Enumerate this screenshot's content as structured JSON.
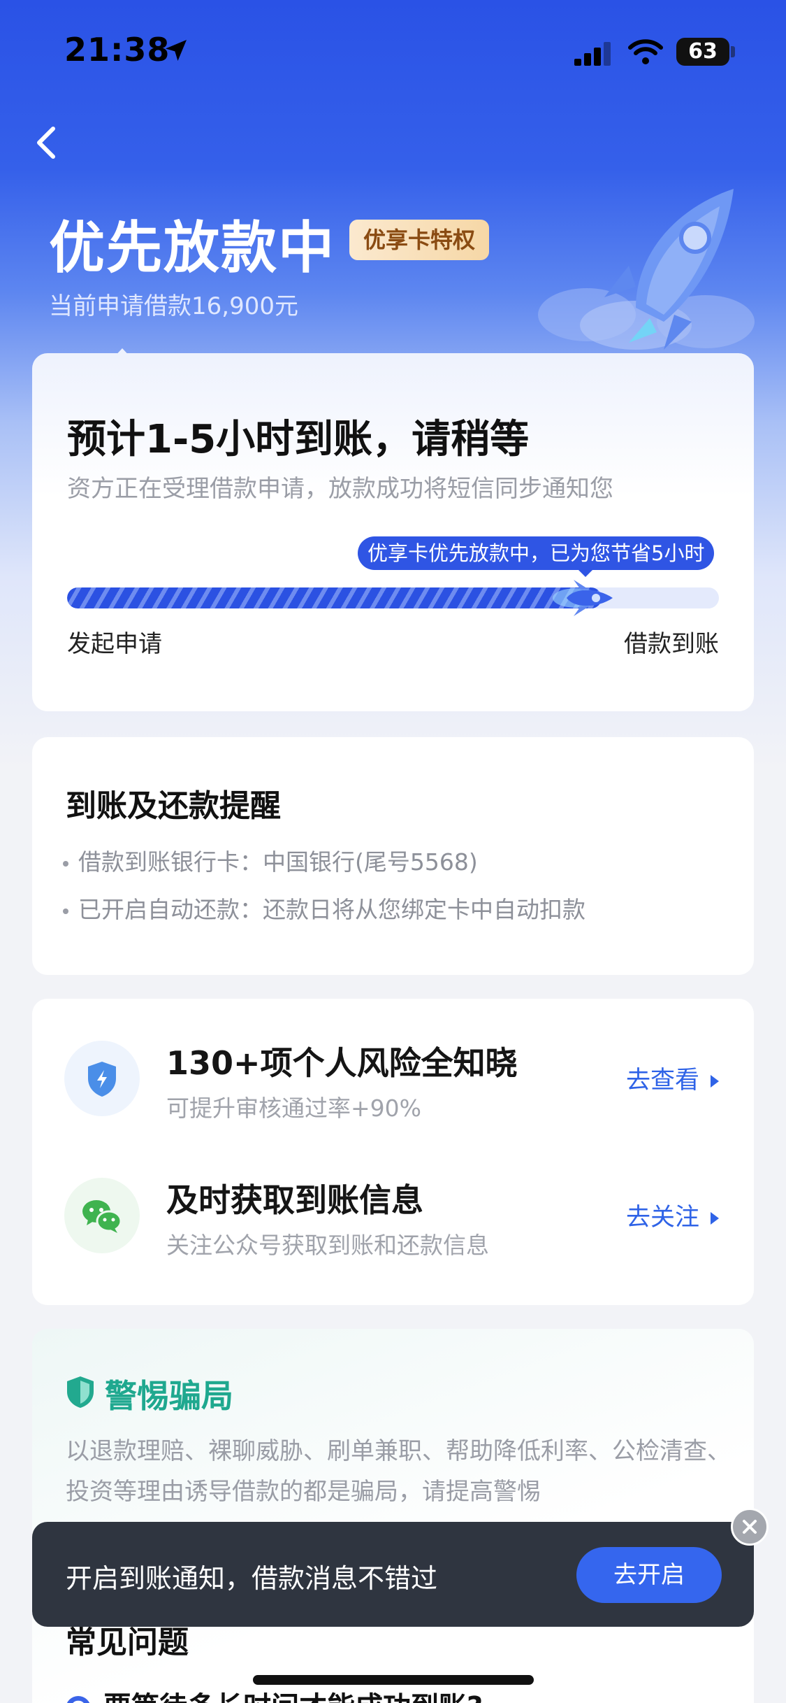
{
  "status_bar": {
    "time": "21:38",
    "battery": "63"
  },
  "header": {
    "title": "优先放款中",
    "badge": "优享卡特权",
    "subtitle": "当前申请借款16,900元"
  },
  "status_card": {
    "eta_title": "预计1-5小时到账，请稍等",
    "eta_desc": "资方正在受理借款申请，放款成功将短信同步通知您",
    "tooltip": "优享卡优先放款中，已为您节省5小时",
    "progress": 0.82,
    "step_start": "发起申请",
    "step_end": "借款到账"
  },
  "reminder": {
    "title": "到账及还款提醒",
    "items": [
      "借款到账银行卡：中国银行(尾号5568)",
      "已开启自动还款：还款日将从您绑定卡中自动扣款"
    ]
  },
  "services": [
    {
      "title": "130+项个人风险全知晓",
      "desc": "可提升审核通过率+90%",
      "link": "去查看",
      "icon": "shield-bolt-icon"
    },
    {
      "title": "及时获取到账信息",
      "desc": "关注公众号获取到账和还款信息",
      "link": "去关注",
      "icon": "wechat-icon"
    }
  ],
  "fraud": {
    "title": "警惕骗局",
    "text": "以退款理赔、裸聊威胁、刷单兼职、帮助降低利率、公检清查、投资等理由诱导借款的都是骗局，请提高警惕"
  },
  "faq": {
    "title": "常见问题",
    "q1": "要等待多长时间才能成功到账?"
  },
  "toast": {
    "text": "开启到账通知，借款消息不错过",
    "button": "去开启"
  },
  "colors": {
    "primary": "#2f55e4",
    "fraud_green": "#1fa88f",
    "toast_bg": "#2f3540"
  }
}
